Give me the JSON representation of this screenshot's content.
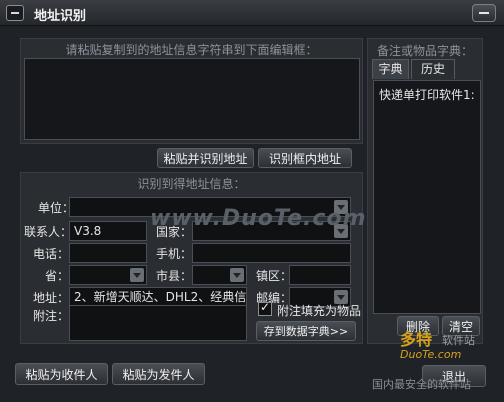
{
  "window": {
    "title": "地址识别"
  },
  "input_panel": {
    "title": "请粘贴复制到的地址信息字符串到下面编辑框："
  },
  "actions": {
    "paste_recognize": "粘贴并识别地址",
    "recognize_in_box": "识别框内地址"
  },
  "result_panel": {
    "title": "识别到得地址信息：",
    "unit_label": "单位：",
    "unit_value": "",
    "contact_label": "联系人：",
    "contact_value": "V3.8",
    "country_label": "国家：",
    "country_value": "",
    "phone_label": "电话：",
    "phone_value": "",
    "mobile_label": "手机：",
    "mobile_value": "",
    "province_label": "省：",
    "province_value": "",
    "city_label": "市县：",
    "city_value": "",
    "town_label": "镇区：",
    "town_value": "",
    "address_label": "地址：",
    "address_value": "2、新增天顺达、DHL2、经典信封",
    "postcode_label": "邮编：",
    "postcode_value": "",
    "note_label": "附注：",
    "append_checkbox_label": "附注填充为物品",
    "append_checked": true,
    "save_dict_button": "存到数据字典>>"
  },
  "dict_panel": {
    "title": "备注或物品字典：",
    "tabs": [
      "字典",
      "历史"
    ],
    "items": [
      "快递单打印软件1:"
    ],
    "delete_button": "删除",
    "clear_button": "清空"
  },
  "bottom": {
    "paste_receiver": "粘贴为收件人",
    "paste_sender": "粘贴为发件人",
    "exit": "退出"
  },
  "watermark": {
    "center": "www.DuoTe.com",
    "brand": "多特",
    "brand_sub": "软件站",
    "domain": "DuoTe.com",
    "slogan": "国内最安全的软件站"
  }
}
